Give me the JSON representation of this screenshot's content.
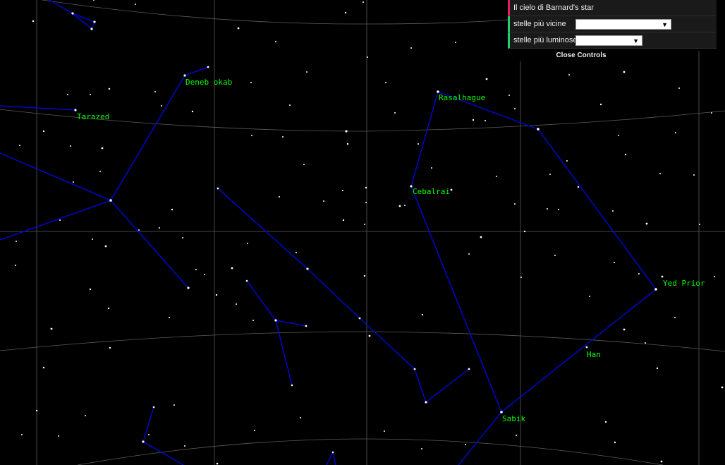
{
  "controls": {
    "title": "Il cielo di Barnard's star",
    "nearest_label": "stelle più vicine",
    "nearest_value": "",
    "brightest_label": "stelle più luminose",
    "brightest_value": "",
    "dropdown_icon": "▼",
    "close_label": "Close Controls"
  },
  "star_names": {
    "deneb_okab": "Deneb okab",
    "tarazed": "Tarazed",
    "rasalhague": "Rasalhague",
    "cebalrai": "Cebalrai",
    "yed_prior": "Yed Prior",
    "han": "Han",
    "sabik": "Sabik"
  },
  "colors": {
    "background": "#000000",
    "constellation_line": "#0000ff",
    "grid_line": "#666666",
    "star_label": "#00ff00",
    "title_accent": "#e61d5f",
    "select_accent": "#1ed36f"
  }
}
